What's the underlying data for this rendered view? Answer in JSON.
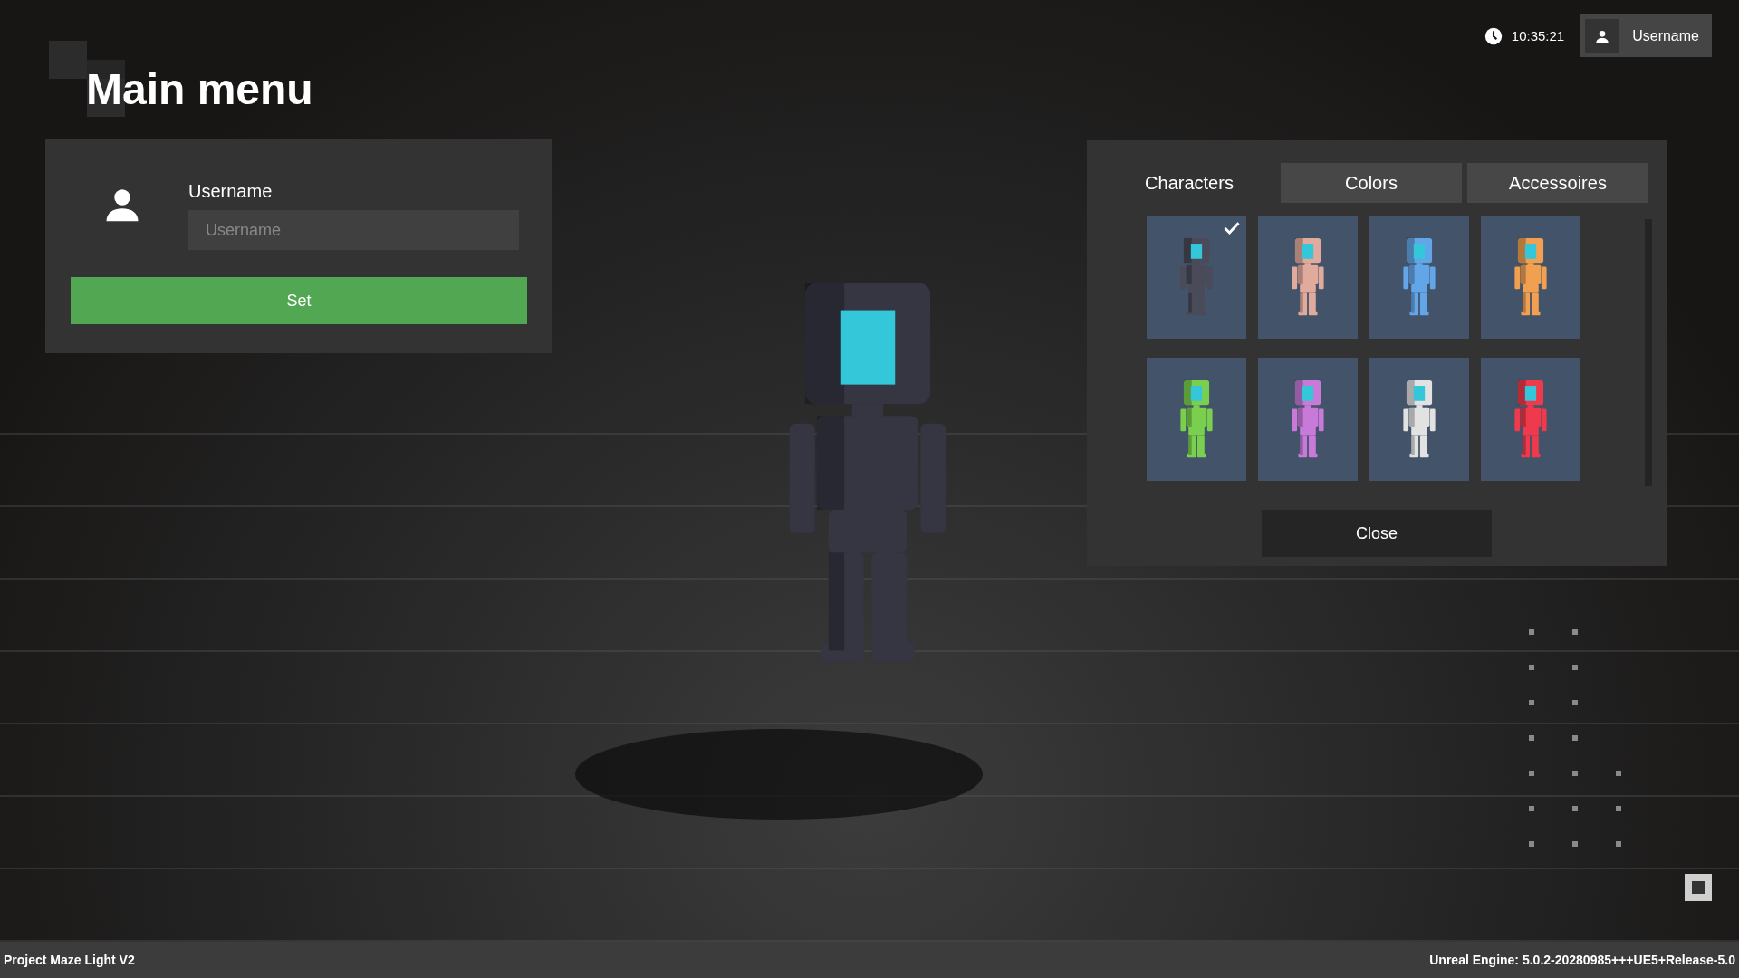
{
  "header": {
    "title": "Main menu",
    "time": "10:35:21",
    "user_button": "Username"
  },
  "profile": {
    "label": "Username",
    "placeholder": "Username",
    "button": "Set"
  },
  "customize": {
    "tabs": [
      {
        "label": "Characters",
        "selected": true
      },
      {
        "label": "Colors",
        "selected": false
      },
      {
        "label": "Accessoires",
        "selected": false
      }
    ],
    "characters": [
      {
        "color": "#4a4a58",
        "selected": true
      },
      {
        "color": "#e0ab9c",
        "selected": false
      },
      {
        "color": "#63a6e8",
        "selected": false
      },
      {
        "color": "#f0a050",
        "selected": false
      },
      {
        "color": "#7ad04e",
        "selected": false
      },
      {
        "color": "#c77ad8",
        "selected": false
      },
      {
        "color": "#e2e2e2",
        "selected": false
      },
      {
        "color": "#ee3a4c",
        "selected": false
      }
    ],
    "close_button": "Close"
  },
  "status_bar": {
    "project": "Project Maze Light V2",
    "engine": "Unreal Engine: 5.0.2-20280985+++UE5+Release-5.0"
  }
}
